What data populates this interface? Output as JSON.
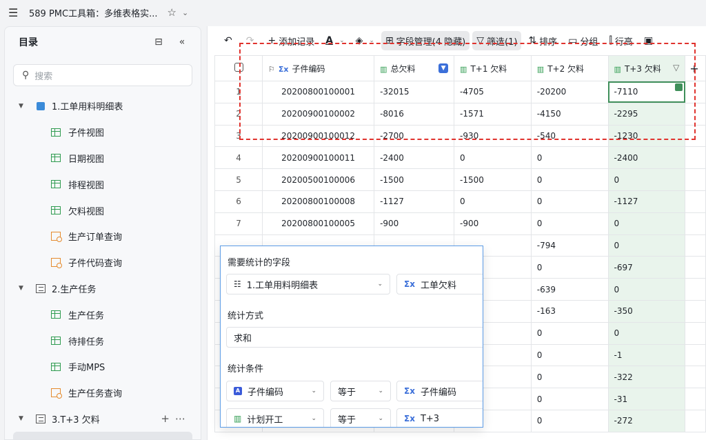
{
  "topbar": {
    "title": "589 PMC工具箱：多维表格实...",
    "menu_icon": "hamburger-icon",
    "star_icon": "star-icon"
  },
  "sidebar": {
    "title": "目录",
    "search_placeholder": "搜索",
    "items": [
      {
        "label": "1.工单用料明细表",
        "type": "group",
        "icon": "sheet-icon"
      },
      {
        "label": "子件视图",
        "type": "grid"
      },
      {
        "label": "日期视图",
        "type": "grid"
      },
      {
        "label": "排程视图",
        "type": "grid"
      },
      {
        "label": "欠料视图",
        "type": "grid"
      },
      {
        "label": "生产订单查询",
        "type": "query"
      },
      {
        "label": "子件代码查询",
        "type": "query"
      },
      {
        "label": "2.生产任务",
        "type": "group",
        "icon": "list-icon"
      },
      {
        "label": "生产任务",
        "type": "grid"
      },
      {
        "label": "待排任务",
        "type": "grid"
      },
      {
        "label": "手动MPS",
        "type": "grid"
      },
      {
        "label": "生产任务查询",
        "type": "query"
      },
      {
        "label": "3.T+3 欠料",
        "type": "group",
        "icon": "list-icon"
      },
      {
        "label": "表格视图",
        "type": "grid"
      }
    ]
  },
  "toolbar": {
    "add_record": "添加记录",
    "field_manage": "字段管理(4 隐藏)",
    "filter": "筛选(1)",
    "sort": "排序",
    "group": "分组",
    "row_height": "行高"
  },
  "table": {
    "columns": [
      "子件编码",
      "总欠料",
      "T+1 欠料",
      "T+2 欠料",
      "T+3 欠料"
    ],
    "rows": [
      {
        "n": "1",
        "code": "20200800100001",
        "total": "-32015",
        "t1": "-4705",
        "t2": "-20200",
        "t3": "-7110"
      },
      {
        "n": "2",
        "code": "20200900100002",
        "total": "-8016",
        "t1": "-1571",
        "t2": "-4150",
        "t3": "-2295"
      },
      {
        "n": "3",
        "code": "20200900100012",
        "total": "-2700",
        "t1": "-930",
        "t2": "-540",
        "t3": "-1230"
      },
      {
        "n": "4",
        "code": "20200900100011",
        "total": "-2400",
        "t1": "0",
        "t2": "0",
        "t3": "-2400"
      },
      {
        "n": "5",
        "code": "20200500100006",
        "total": "-1500",
        "t1": "-1500",
        "t2": "0",
        "t3": "0"
      },
      {
        "n": "6",
        "code": "20200800100008",
        "total": "-1127",
        "t1": "0",
        "t2": "0",
        "t3": "-1127"
      },
      {
        "n": "7",
        "code": "20200800100005",
        "total": "-900",
        "t1": "-900",
        "t2": "0",
        "t3": "0"
      },
      {
        "n": "",
        "code": "",
        "total": "",
        "t1": "",
        "t2": "-794",
        "t3": "0"
      },
      {
        "n": "",
        "code": "",
        "total": "",
        "t1": "",
        "t2": "0",
        "t3": "-697"
      },
      {
        "n": "",
        "code": "",
        "total": "",
        "t1": "",
        "t2": "-639",
        "t3": "0"
      },
      {
        "n": "",
        "code": "",
        "total": "",
        "t1": "",
        "t2": "-163",
        "t3": "-350"
      },
      {
        "n": "",
        "code": "",
        "total": "",
        "t1": "",
        "t2": "0",
        "t3": "0"
      },
      {
        "n": "",
        "code": "",
        "total": "",
        "t1": "",
        "t2": "0",
        "t3": "-1"
      },
      {
        "n": "",
        "code": "",
        "total": "",
        "t1": "",
        "t2": "0",
        "t3": "-322"
      },
      {
        "n": "",
        "code": "",
        "total": "",
        "t1": "",
        "t2": "0",
        "t3": "-31"
      },
      {
        "n": "",
        "code": "",
        "total": "",
        "t1": "",
        "t2": "0",
        "t3": "-272"
      }
    ]
  },
  "popup": {
    "field_label": "需要统计的字段",
    "field_table": "1.工单用料明细表",
    "field_name": "工单欠料",
    "method_label": "统计方式",
    "method_value": "求和",
    "cond_label": "统计条件",
    "cond1": {
      "field": "子件编码",
      "op": "等于",
      "value": "子件编码"
    },
    "cond2": {
      "field": "计划开工",
      "op": "等于",
      "value": "T+3"
    }
  },
  "colors": {
    "accent": "#3b6fd9",
    "highlight_column": "#e9f4ec",
    "annotation": "#e0322d",
    "selection": "#3f8f5a"
  }
}
